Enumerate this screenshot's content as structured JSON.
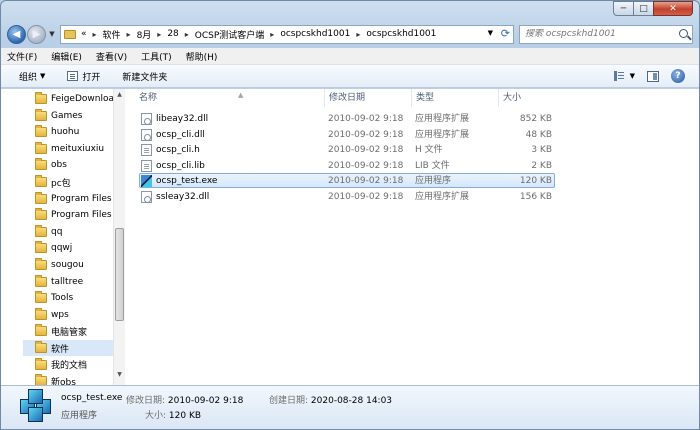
{
  "window": {
    "min_glyph": "─",
    "max_glyph": "□",
    "close_glyph": "✕"
  },
  "address": {
    "prefix": "«",
    "crumbs": [
      "软件",
      "8月",
      "28",
      "OCSP测试客户端",
      "ocspcskhd1001",
      "ocspcskhd1001"
    ]
  },
  "search": {
    "placeholder": "搜索 ocspcskhd1001"
  },
  "menu": [
    "文件(F)",
    "编辑(E)",
    "查看(V)",
    "工具(T)",
    "帮助(H)"
  ],
  "toolbar": {
    "organize": "组织",
    "open": "打开",
    "new_folder": "新建文件夹"
  },
  "nav_folders": [
    "FeigeDownloa",
    "Games",
    "huohu",
    "meituxiuxiu",
    "obs",
    "pc包",
    "Program Files",
    "Program Files",
    "qq",
    "qqwj",
    "sougou",
    "talltree",
    "Tools",
    "wps",
    "电脑管家",
    "软件",
    "我的文档",
    "新obs"
  ],
  "nav_selected": "软件",
  "columns": {
    "name": "名称",
    "date": "修改日期",
    "type": "类型",
    "size": "大小"
  },
  "files": [
    {
      "name": "libeay32.dll",
      "date": "2010-09-02 9:18",
      "type": "应用程序扩展",
      "size": "852 KB",
      "icon": "dll"
    },
    {
      "name": "ocsp_cli.dll",
      "date": "2010-09-02 9:18",
      "type": "应用程序扩展",
      "size": "48 KB",
      "icon": "dll"
    },
    {
      "name": "ocsp_cli.h",
      "date": "2010-09-02 9:18",
      "type": "H 文件",
      "size": "3 KB",
      "icon": "txt"
    },
    {
      "name": "ocsp_cli.lib",
      "date": "2010-09-02 9:18",
      "type": "LIB 文件",
      "size": "2 KB",
      "icon": "txt"
    },
    {
      "name": "ocsp_test.exe",
      "date": "2010-09-02 9:18",
      "type": "应用程序",
      "size": "120 KB",
      "icon": "exe"
    },
    {
      "name": "ssleay32.dll",
      "date": "2010-09-02 9:18",
      "type": "应用程序扩展",
      "size": "156 KB",
      "icon": "dll"
    }
  ],
  "selected_file": "ocsp_test.exe",
  "status": {
    "name": "ocsp_test.exe",
    "kind": "应用程序",
    "modified_label": "修改日期:",
    "modified": "2010-09-02 9:18",
    "created_label": "创建日期:",
    "created": "2020-08-28 14:03",
    "size_label": "大小:",
    "size": "120 KB"
  }
}
